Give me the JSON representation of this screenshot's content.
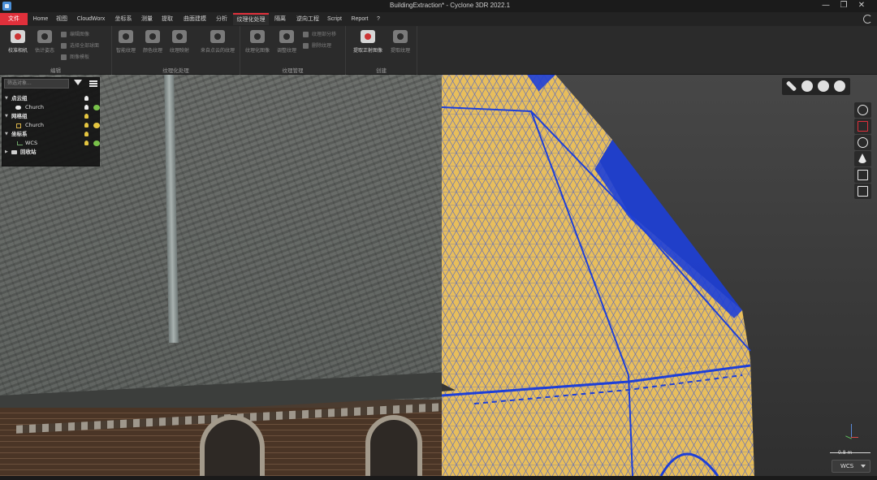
{
  "window": {
    "title": "BuildingExtraction* - Cyclone 3DR 2022.1",
    "minimize": "—",
    "restore": "❐",
    "close": "✕"
  },
  "menu": {
    "items": [
      "文件",
      "Home",
      "视图",
      "CloudWorx",
      "坐标系",
      "测量",
      "提取",
      "曲面建模",
      "分析",
      "纹理化处理",
      "隔离",
      "逆向工程",
      "Script",
      "Report",
      "?"
    ],
    "active": "纹理化处理"
  },
  "ribbon": {
    "groups": [
      {
        "label": "编辑",
        "large": [
          {
            "label": "校准相机",
            "icon": "camera-calibrate-icon",
            "enabled": true
          },
          {
            "label": "估计姿态",
            "icon": "camera-icon",
            "enabled": false
          }
        ],
        "small": [
          {
            "label": "编辑图像",
            "icon": "edit-image-icon"
          },
          {
            "label": "选择全部球面",
            "icon": "select-spheres-icon"
          },
          {
            "label": "图像模板",
            "icon": "image-template-icon"
          }
        ]
      },
      {
        "label": "纹理化处理",
        "large": [
          {
            "label": "智能纹理",
            "icon": "smart-texture-icon",
            "enabled": false
          },
          {
            "label": "颜色纹理",
            "icon": "color-texture-icon",
            "enabled": false
          },
          {
            "label": "纹理映射",
            "icon": "texture-map-icon",
            "enabled": false
          },
          {
            "label": "来自点云的纹理",
            "icon": "cloud-texture-icon",
            "enabled": false
          }
        ]
      },
      {
        "label": "纹理管理",
        "large": [
          {
            "label": "纹理化图像",
            "icon": "textured-image-icon",
            "enabled": false
          },
          {
            "label": "调整纹理",
            "icon": "adjust-texture-icon",
            "enabled": false
          }
        ],
        "small": [
          {
            "label": "纹理部分移",
            "icon": "texture-move-icon"
          },
          {
            "label": "删除纹理",
            "icon": "delete-texture-icon"
          }
        ]
      },
      {
        "label": "创建",
        "large": [
          {
            "label": "提取正射图像",
            "icon": "ortho-image-icon",
            "enabled": true
          },
          {
            "label": "提取纹理",
            "icon": "extract-texture-icon",
            "enabled": false
          }
        ]
      }
    ]
  },
  "tree": {
    "filter_placeholder": "筛选对象...",
    "rows": [
      {
        "label": "点云组",
        "kind": "group",
        "bulb": "white",
        "eye": "none"
      },
      {
        "label": "Church",
        "kind": "cloud",
        "bulb": "white",
        "eye": "green"
      },
      {
        "label": "网格组",
        "kind": "group",
        "bulb": "yellow",
        "eye": "none"
      },
      {
        "label": "Church",
        "kind": "mesh",
        "bulb": "yellow",
        "eye": "green"
      },
      {
        "label": "坐标系",
        "kind": "group",
        "bulb": "yellow",
        "eye": "none"
      },
      {
        "label": "WCS",
        "kind": "axes",
        "bulb": "yellow",
        "eye": "green"
      },
      {
        "label": "回收站",
        "kind": "trash",
        "bulb": "none",
        "eye": "none"
      }
    ]
  },
  "viewport": {
    "scale_label": "0.8 m",
    "coordinate_system": "WCS"
  },
  "colors": {
    "accent": "#e0303b",
    "mesh_fill": "#e8be5c",
    "mesh_wire": "#1d3fd8",
    "bulb_yellow": "#e5c640",
    "eye_green": "#79c24a"
  }
}
